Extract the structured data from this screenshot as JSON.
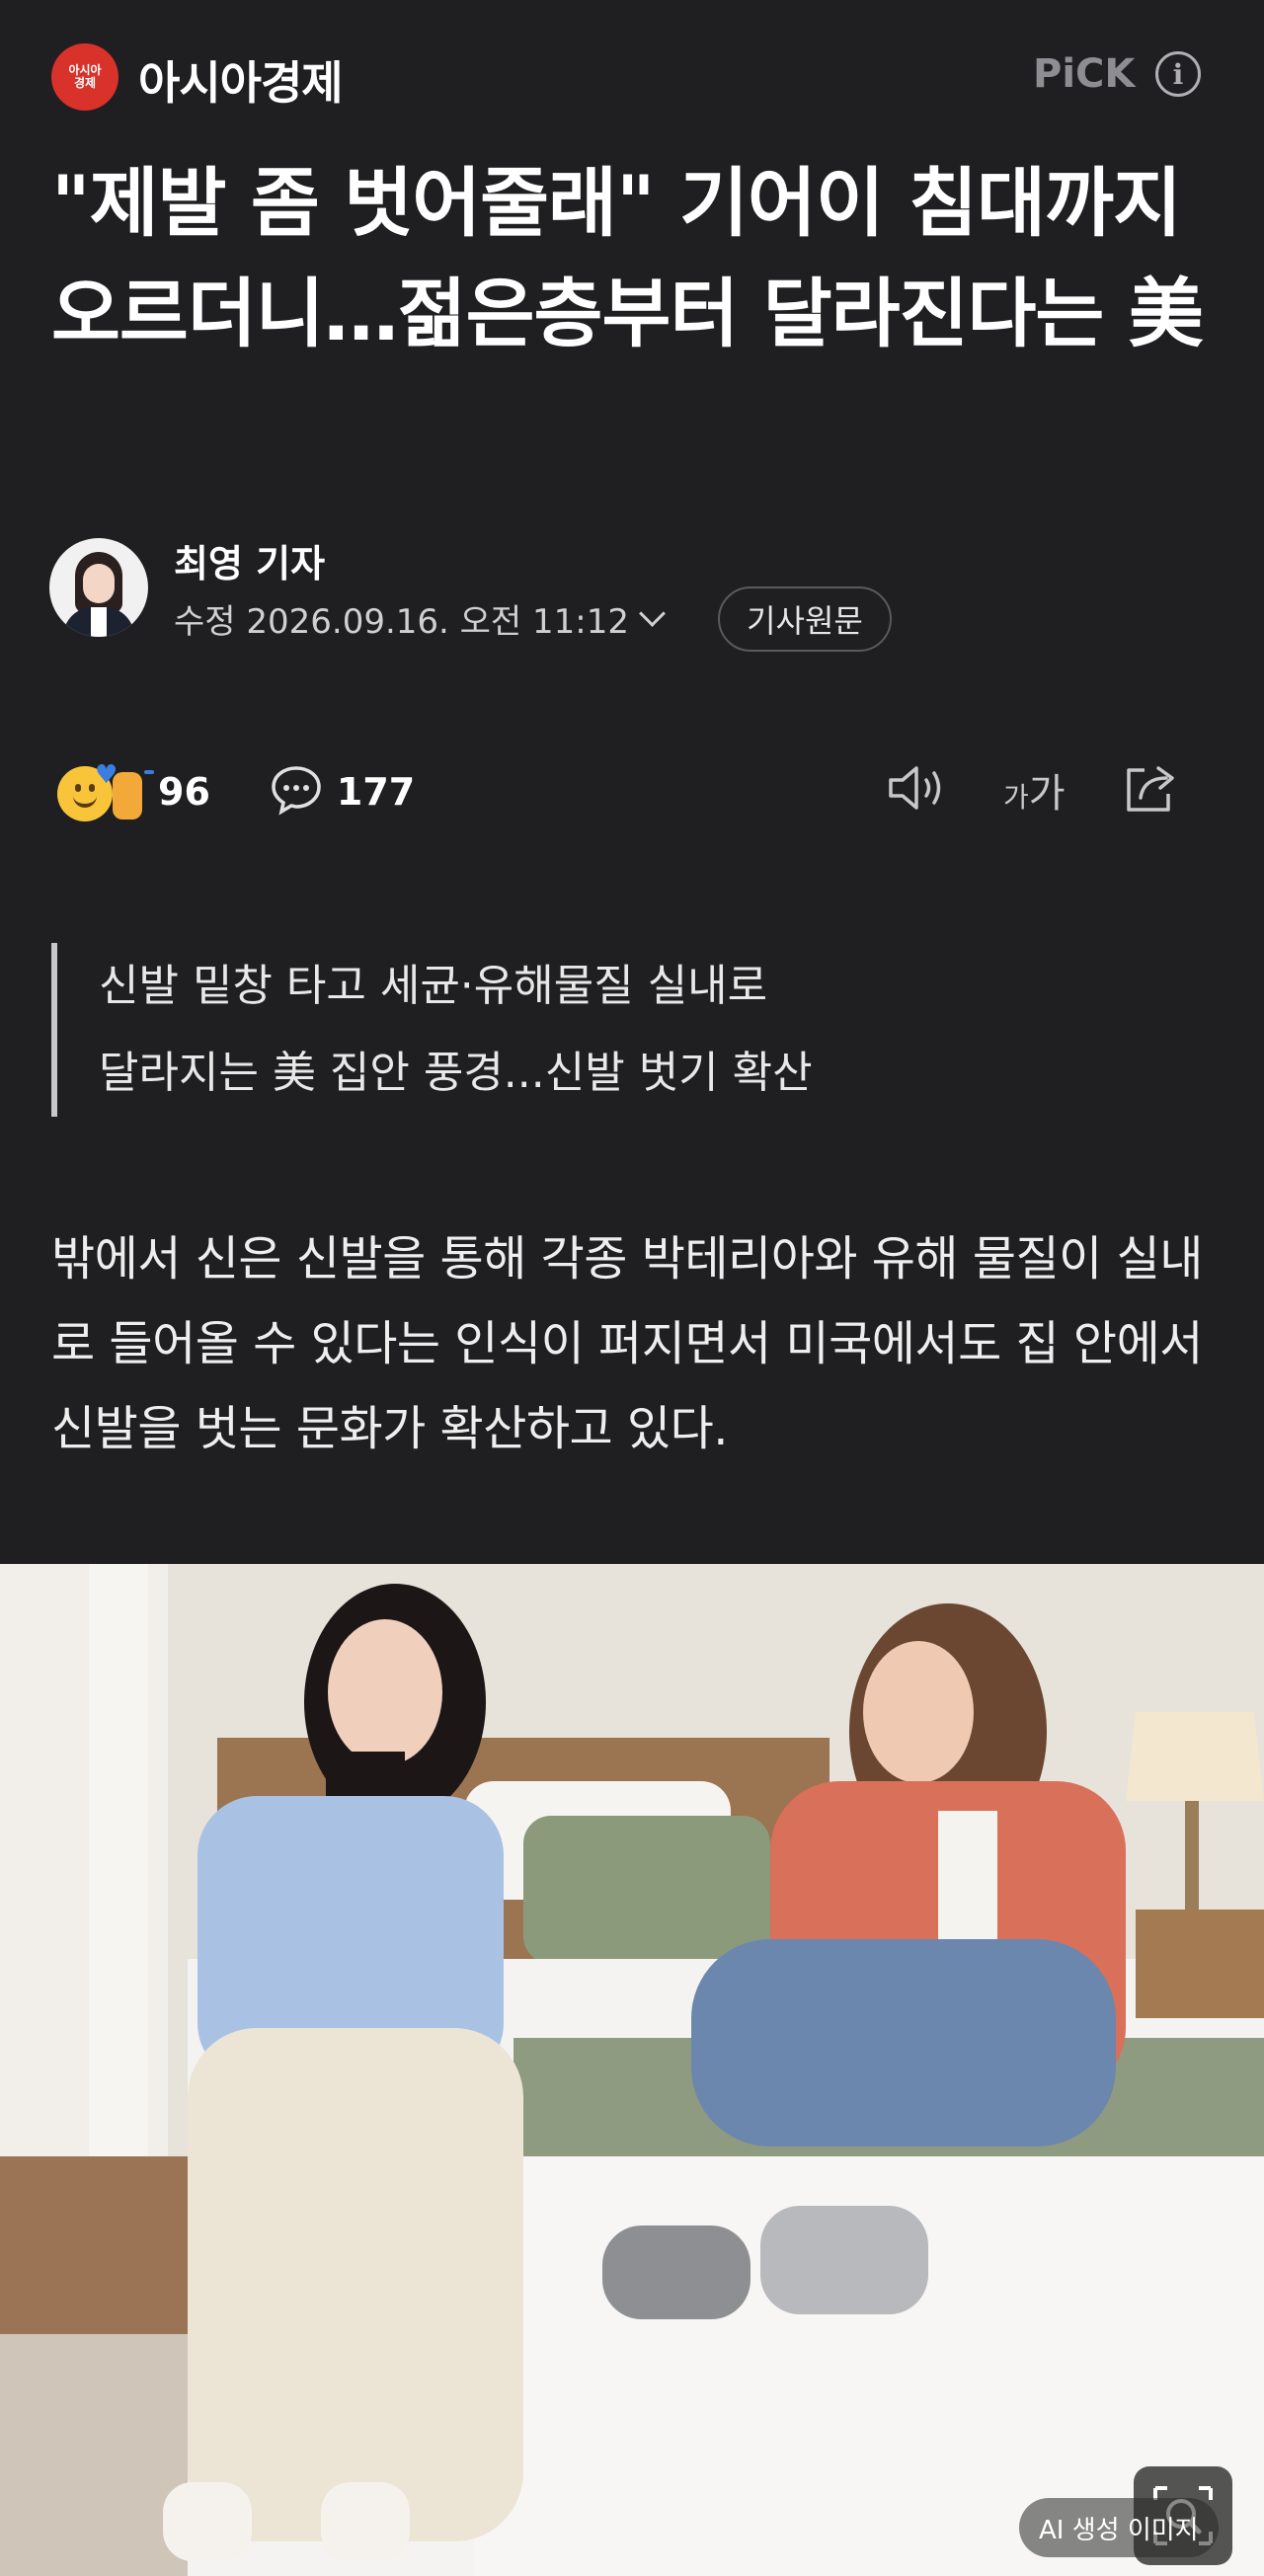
{
  "header": {
    "logo_text": "아시아 경제",
    "logo_line1": "아시아",
    "logo_line2": "경제",
    "brand_name": "아시아경제",
    "pick_logo": "PiCK",
    "info_icon": "info-icon"
  },
  "article": {
    "headline": "\"제발 좀 벗어줄래\" 기어이 침대까지 오르더니…젊은층부터 달라진다는 美",
    "reporter": "최영 기자",
    "dateline": "수정 2026.09.16. 오전 11:12",
    "source_button": "기사원문",
    "reaction_count": "96",
    "comment_count": "177",
    "subtitle_lines": [
      "신발 밑창 타고 세균·유해물질 실내로",
      "달라지는 美 집안 풍경...신발 벗기 확산"
    ],
    "body": "밖에서 신은 신발을 통해 각종 박테리아와 유해 물질이 실내로 들어올 수 있다는 인식이 퍼지면서 미국에서도 집 안에서 신발을 벗는 문화가 확산하고 있다.",
    "image_badge": "AI 생성 이미지"
  },
  "toolbar": {
    "font_size_small": "가",
    "font_size_large": "가"
  },
  "colors": {
    "background": "#1f1f21",
    "logo_red": "#d8322a",
    "accent_muted": "#8e8e92"
  }
}
